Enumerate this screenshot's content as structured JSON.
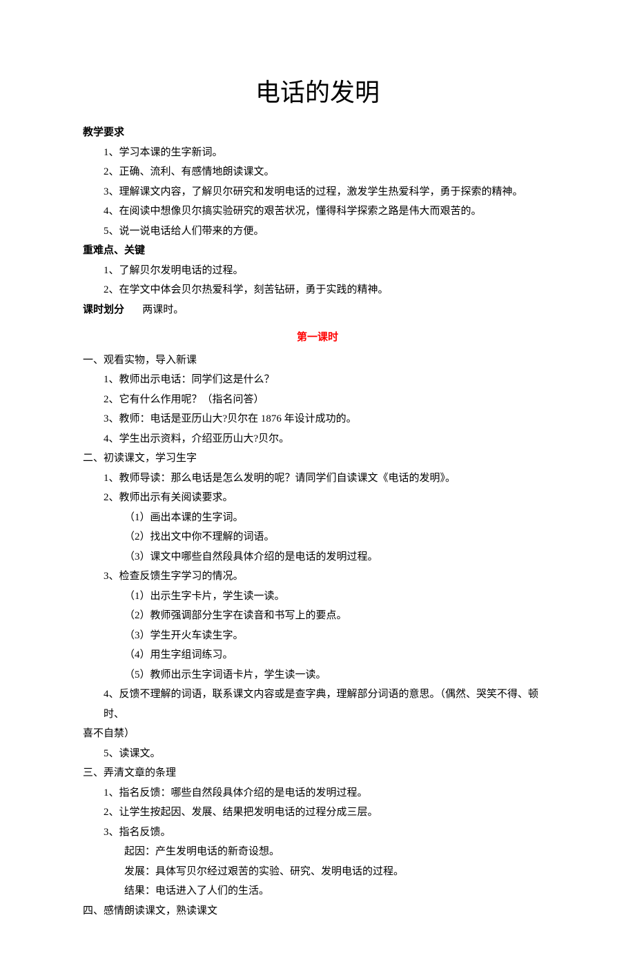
{
  "title": "电话的发明",
  "sections": {
    "teaching_requirements": {
      "label": "教学要求",
      "items": [
        "1、学习本课的生字新词。",
        "2、正确、流利、有感情地朗读课文。",
        "3、理解课文内容，了解贝尔研究和发明电话的过程，激发学生热爱科学，勇于探索的精神。",
        "4、在阅读中想像贝尔搞实验研究的艰苦状况，懂得科学探索之路是伟大而艰苦的。",
        "5、说一说电话给人们带来的方便。"
      ]
    },
    "key_points": {
      "label": "重难点、关键",
      "items": [
        "1、了解贝尔发明电话的过程。",
        "2、在学文中体会贝尔热爱科学，刻苦钻研，勇于实践的精神。"
      ]
    },
    "class_division": {
      "label": "课时划分",
      "value": "两课时。"
    },
    "lesson1": {
      "header": "第一课时",
      "sec1": {
        "heading": "一、观看实物，导入新课",
        "items": [
          "1、教师出示电话：同学们这是什么？",
          "2、它有什么作用呢？（指名问答）",
          "3、教师：电话是亚历山大?贝尔在 1876 年设计成功的。",
          "4、学生出示资料，介绍亚历山大?贝尔。"
        ]
      },
      "sec2": {
        "heading": "二、初读课文，学习生字",
        "item1": "1、教师导读：那么电话是怎么发明的呢？请同学们自读课文《电话的发明》。",
        "item2": "2、教师出示有关阅读要求。",
        "item2_sub": [
          "（1）画出本课的生字词。",
          "（2）找出文中你不理解的词语。",
          "（3）课文中哪些自然段具体介绍的是电话的发明过程。"
        ],
        "item3": "3、检查反馈生字学习的情况。",
        "item3_sub": [
          "（1）出示生字卡片，学生读一读。",
          "（2）教师强调部分生字在读音和书写上的要点。",
          "（3）学生开火车读生字。",
          "（4）用生字组词练习。",
          "（5）教师出示生字词语卡片，学生读一读。"
        ],
        "item4_line1": "4、反馈不理解的词语，联系课文内容或是查字典，理解部分词语的意思。（偶然、哭笑不得、顿时、",
        "item4_line2": "喜不自禁）",
        "item5": "5、读课文。"
      },
      "sec3": {
        "heading": "三、弄清文章的条理",
        "item1": "1、指名反馈：哪些自然段具体介绍的是电话的发明过程。",
        "item2": "2、让学生按起因、发展、结果把发明电话的过程分成三层。",
        "item3": "3、指名反馈。",
        "item3_sub": [
          "起因：产生发明电话的新奇设想。",
          "发展：具体写贝尔经过艰苦的实验、研究、发明电话的过程。",
          "结果：电话进入了人们的生活。"
        ]
      },
      "sec4": {
        "heading": "四、感情朗读课文，熟读课文"
      }
    }
  }
}
